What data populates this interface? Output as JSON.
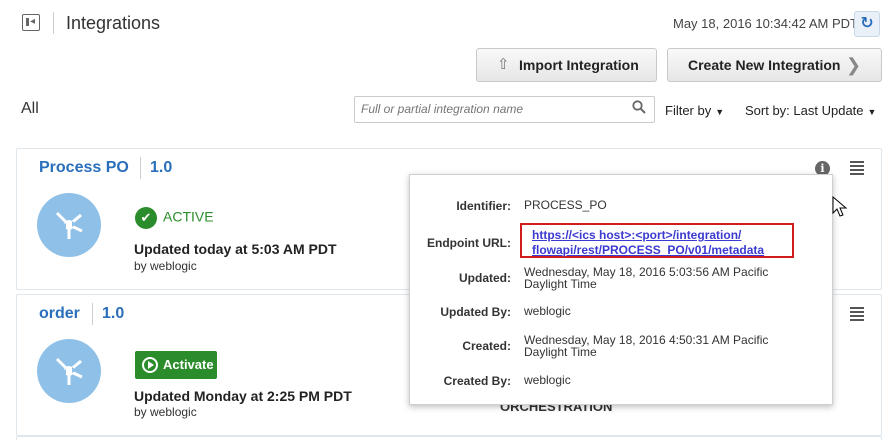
{
  "header": {
    "title": "Integrations",
    "timestamp": "May 18, 2016 10:34:42 AM PDT",
    "refresh_icon": "refresh-icon"
  },
  "toolbar": {
    "import_label": "Import Integration",
    "create_label": "Create New Integration"
  },
  "filters": {
    "scope": "All",
    "search_placeholder": "Full or partial integration name",
    "filter_label": "Filter by",
    "sort_label": "Sort by: Last Update"
  },
  "integrations": [
    {
      "name": "Process PO",
      "version": "1.0",
      "status": "ACTIVE",
      "updated": "Updated today at 5:03 AM PDT",
      "by": "by weblogic"
    },
    {
      "name": "order",
      "version": "1.0",
      "action": "Activate",
      "updated": "Updated Monday at 2:25 PM PDT",
      "by": "by weblogic",
      "pattern": "ORCHESTRATION"
    }
  ],
  "popup": {
    "identifier_label": "Identifier:",
    "identifier": "PROCESS_PO",
    "endpoint_label": "Endpoint URL:",
    "endpoint_line1": "https://<ics host>:<port>/integration/",
    "endpoint_line2": "flowapi/rest/PROCESS_PO/v01/metadata",
    "updated_label": "Updated:",
    "updated_line1": "Wednesday, May 18, 2016 5:03:56 AM Pacific",
    "updated_line2": "Daylight Time",
    "updated_by_label": "Updated By:",
    "updated_by": "weblogic",
    "created_label": "Created:",
    "created_line1": "Wednesday, May 18, 2016 4:50:31 AM Pacific",
    "created_line2": "Daylight Time",
    "created_by_label": "Created By:",
    "created_by": "weblogic"
  },
  "colors": {
    "link_blue": "#2a6fbb",
    "active_green": "#2b8c2b",
    "highlight_red": "#d21c1c"
  }
}
